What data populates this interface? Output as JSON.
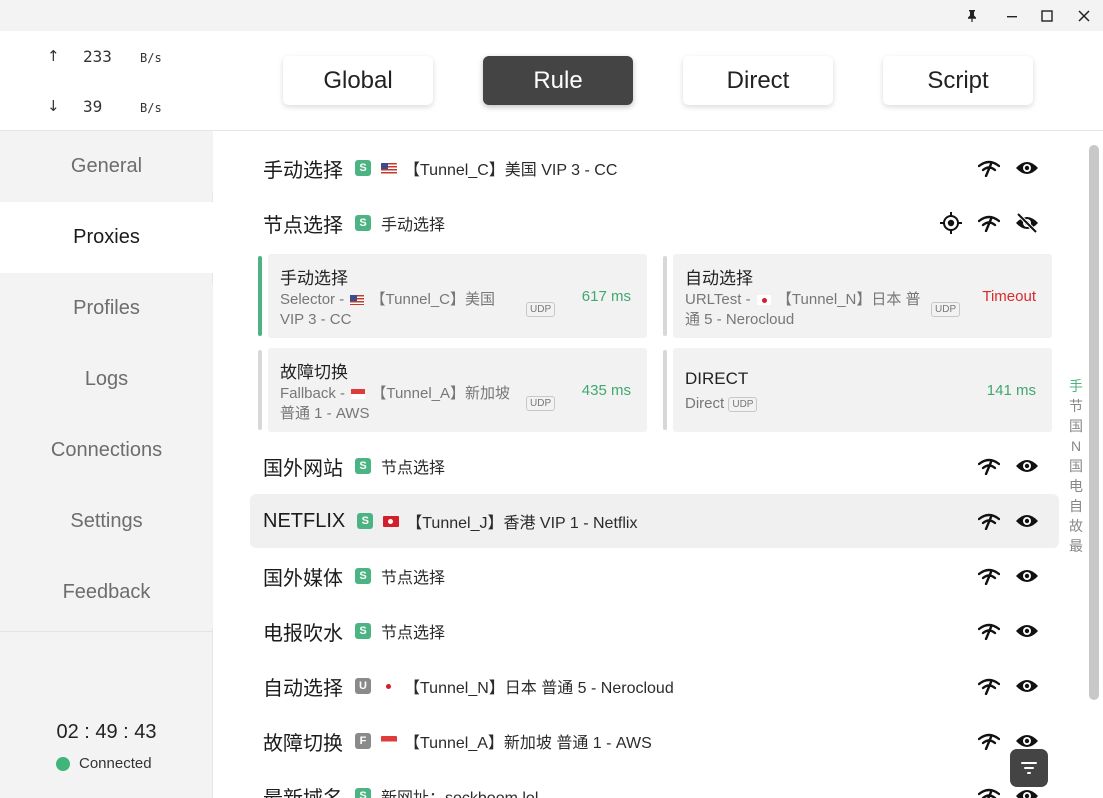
{
  "window": {
    "pin_icon": "pin-icon",
    "minimize_icon": "minimize-icon",
    "maximize_icon": "maximize-icon",
    "close_icon": "close-icon"
  },
  "traffic": {
    "up_arrow": "↑",
    "up_value": "233",
    "up_unit": "B/s",
    "down_arrow": "↓",
    "down_value": "39",
    "down_unit": "B/s"
  },
  "nav": {
    "general": "General",
    "proxies": "Proxies",
    "profiles": "Profiles",
    "logs": "Logs",
    "connections": "Connections",
    "settings": "Settings",
    "feedback": "Feedback"
  },
  "status": {
    "uptime": "02 : 49 : 43",
    "connection": "Connected",
    "connection_color": "#3fb57a"
  },
  "modes": {
    "global": "Global",
    "rule": "Rule",
    "direct": "Direct",
    "script": "Script",
    "active": "Rule"
  },
  "groups": [
    {
      "name": "手动选择",
      "type": "S",
      "flag": "us",
      "selected": "【Tunnel_C】美国 VIP 3 - CC",
      "hide_icon": "eye-icon"
    },
    {
      "name": "节点选择",
      "type": "S",
      "flag": "",
      "selected": "手动选择",
      "hide_icon": "eye-off-icon",
      "expanded": true
    },
    {
      "name": "国外网站",
      "type": "S",
      "flag": "",
      "selected": "节点选择",
      "hide_icon": "eye-icon"
    },
    {
      "name": "NETFLIX",
      "type": "S",
      "flag": "hk",
      "selected": "【Tunnel_J】香港 VIP 1 - Netflix",
      "hide_icon": "eye-icon"
    },
    {
      "name": "国外媒体",
      "type": "S",
      "flag": "",
      "selected": "节点选择",
      "hide_icon": "eye-icon"
    },
    {
      "name": "电报吹水",
      "type": "S",
      "flag": "",
      "selected": "节点选择",
      "hide_icon": "eye-icon"
    },
    {
      "name": "自动选择",
      "type": "U",
      "flag": "jp",
      "selected": "【Tunnel_N】日本 普通 5 - Nerocloud",
      "hide_icon": "eye-icon"
    },
    {
      "name": "故障切换",
      "type": "F",
      "flag": "sg",
      "selected": "【Tunnel_A】新加坡 普通 1 - AWS",
      "hide_icon": "eye-icon"
    },
    {
      "name": "最新域名",
      "type": "S",
      "flag": "",
      "selected": "新网址：sockboom.lol",
      "hide_icon": "eye-icon"
    }
  ],
  "cards": [
    {
      "name": "手动选择",
      "sub_prefix": "Selector - ",
      "flag": "us",
      "sub_text": "【Tunnel_C】美国 VIP 3 - CC",
      "udp": "UDP",
      "delay": "617 ms",
      "selected": true
    },
    {
      "name": "自动选择",
      "sub_prefix": "URLTest - ",
      "flag": "jp",
      "sub_text": "【Tunnel_N】日本 普通 5 - Nerocloud",
      "udp": "UDP",
      "delay": "Timeout",
      "selected": false
    },
    {
      "name": "故障切换",
      "sub_prefix": "Fallback - ",
      "flag": "sg",
      "sub_text": "【Tunnel_A】新加坡 普通 1 - AWS",
      "udp": "UDP",
      "delay": "435 ms",
      "selected": false
    },
    {
      "name": "DIRECT",
      "sub_prefix": "Direct",
      "flag": "",
      "sub_text": "",
      "udp": "UDP",
      "delay": "141 ms",
      "selected": false
    }
  ],
  "side_index": [
    "手",
    "节",
    "国",
    "N",
    "国",
    "电",
    "自",
    "故",
    "最"
  ],
  "side_index_current": 0,
  "fab_icon": "filter-icon",
  "colors": {
    "accent_green": "#4cb383",
    "delay_green": "#3fa870",
    "timeout_red": "#d92b2b",
    "active_mode": "#444444"
  }
}
